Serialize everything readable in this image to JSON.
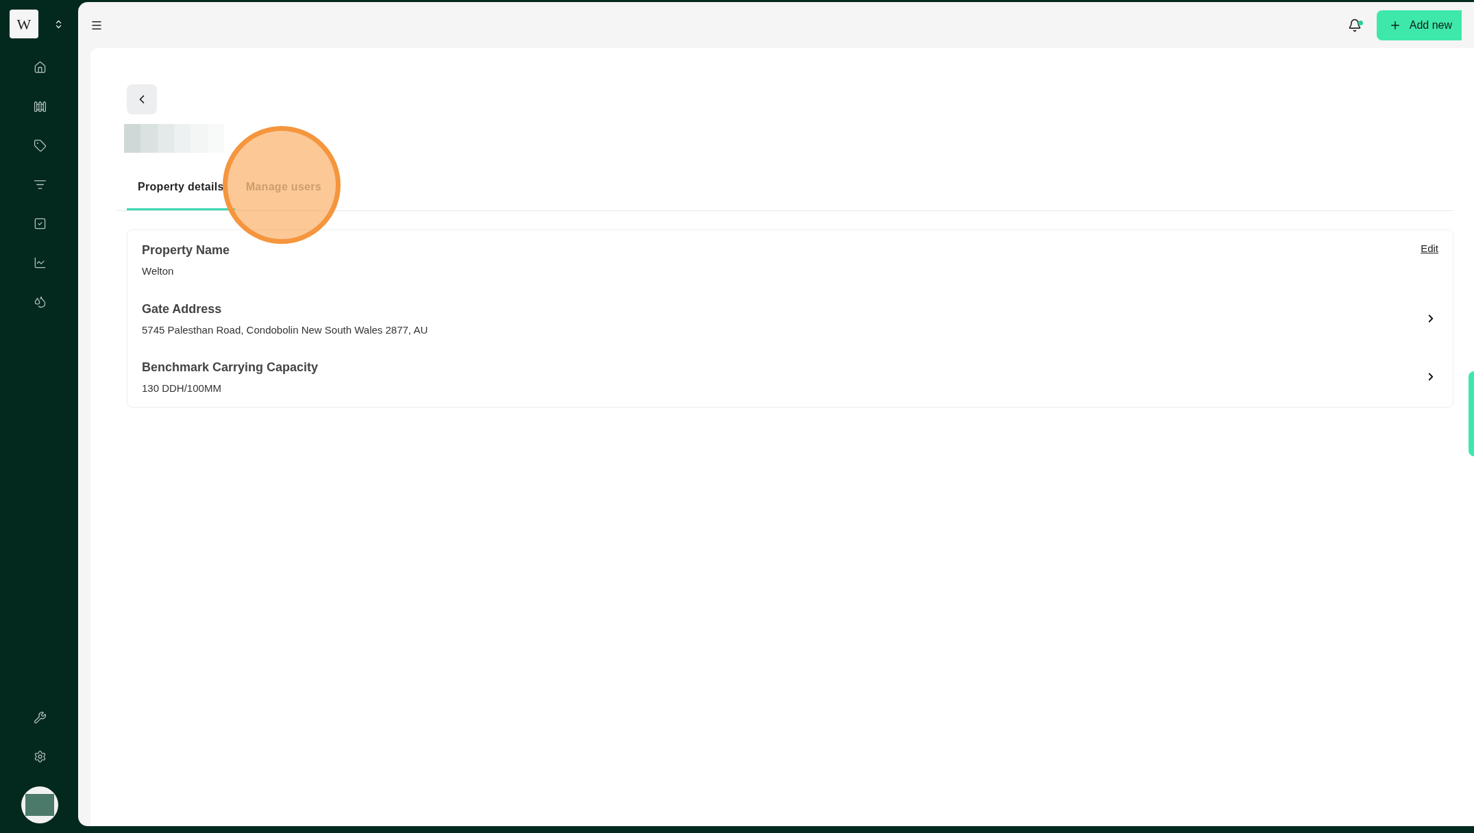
{
  "sidebar": {
    "logo": "W"
  },
  "header": {
    "add_button": "Add new",
    "notification_dot": true
  },
  "tabs": [
    {
      "label": "Property details",
      "selected": true
    },
    {
      "label": "Manage users",
      "selected": false
    }
  ],
  "details": [
    {
      "label": "Property Name",
      "value": "Welton",
      "kind": "edit",
      "action_label": "Edit"
    },
    {
      "label": "Gate Address",
      "value": "5745 Palesthan Road, Condobolin New South Wales 2877, AU",
      "kind": "chevron"
    },
    {
      "label": "Benchmark Carrying Capacity",
      "value": "130 DDH/100MM",
      "kind": "chevron"
    }
  ]
}
